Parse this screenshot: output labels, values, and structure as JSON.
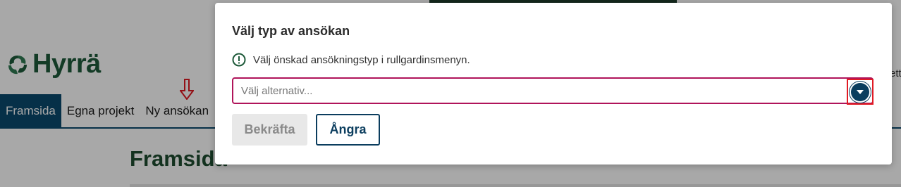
{
  "background": {
    "logo_text": "Hyrrä",
    "nav": [
      {
        "label": "Framsida",
        "active": true
      },
      {
        "label": "Egna projekt",
        "active": false
      },
      {
        "label": "Ny ansökan",
        "active": false
      }
    ],
    "page_title": "Framsida",
    "right_fragment": "ett"
  },
  "modal": {
    "title": "Välj typ av ansökan",
    "info_text": "Välj önskad ansökningstyp i rullgardinsmenyn.",
    "select_placeholder": "Välj alternativ...",
    "confirm_label": "Bekräfta",
    "cancel_label": "Ångra"
  },
  "colors": {
    "brand_green": "#1e5a3a",
    "nav_active": "#0a4a6e",
    "select_border": "#b0145a",
    "highlight_red": "#e01b24",
    "button_primary": "#0b3d5e"
  },
  "icons": {
    "info": "info-circle-icon",
    "dropdown": "chevron-down-icon",
    "annotation": "down-arrow-icon"
  }
}
